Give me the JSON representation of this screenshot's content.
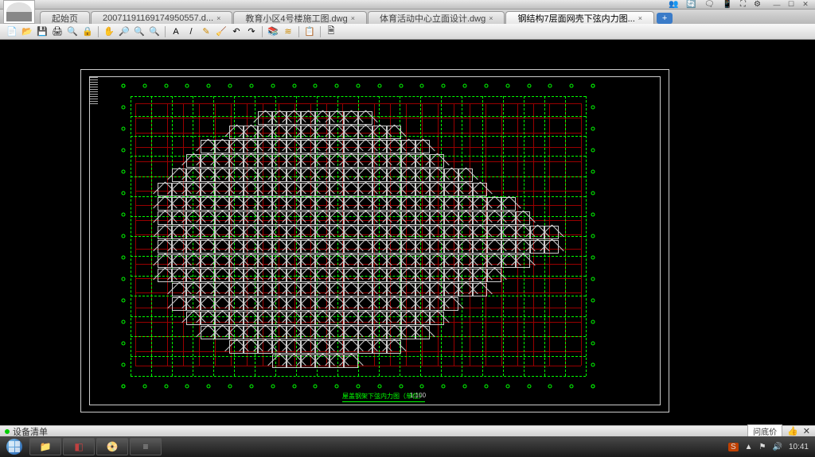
{
  "titlebar": {
    "sys_icons": [
      "👥",
      "🔄",
      "🗨",
      "📱",
      "⛶",
      "⚙"
    ]
  },
  "win_controls": {
    "min": "—",
    "max": "☐",
    "close": "✕"
  },
  "tabs": [
    {
      "label": "起始页",
      "active": false
    },
    {
      "label": "20071191169174950557.d...",
      "active": false
    },
    {
      "label": "教育小区4号楼施工图.dwg",
      "active": false
    },
    {
      "label": "体育活动中心立面设计.dwg",
      "active": false
    },
    {
      "label": "钢结构7层面网壳下弦内力图...",
      "active": true
    }
  ],
  "newtab": "+",
  "toolbar": {
    "new": "📄",
    "open": "📂",
    "save": "💾",
    "print": "🖨",
    "preview": "🔍",
    "lock": "🔒",
    "pan": "✋",
    "zoomext": "🔎",
    "zoomin": "🔍",
    "zoomout": "🔍",
    "text": "A",
    "line": "/",
    "pen": "✎",
    "erase": "🧹",
    "undo": "↶",
    "redo": "↷",
    "layer1": "📚",
    "layer2": "≋",
    "list": "📋",
    "props": "🗎"
  },
  "drawing": {
    "title": "屋盖钢架下弦内力图（单位）",
    "suffix": "1:100",
    "grid_cols": 22,
    "grid_rows": 14,
    "red_cols": 28,
    "red_rows": 18
  },
  "status": {
    "left_label": "设备清单",
    "price_label": "问底价",
    "like": "👍",
    "close": "✕"
  },
  "taskbar": {
    "apps": [
      {
        "icon": "📁",
        "color": "#f0d060"
      },
      {
        "icon": "◧",
        "color": "#c04040"
      },
      {
        "icon": "📀",
        "color": "#4080c0"
      },
      {
        "icon": "≡",
        "color": "#505050"
      }
    ],
    "tray": {
      "s_icon": "S",
      "net": "▲",
      "flag": "⚑",
      "sound": "🔊",
      "time": "10:41"
    }
  }
}
